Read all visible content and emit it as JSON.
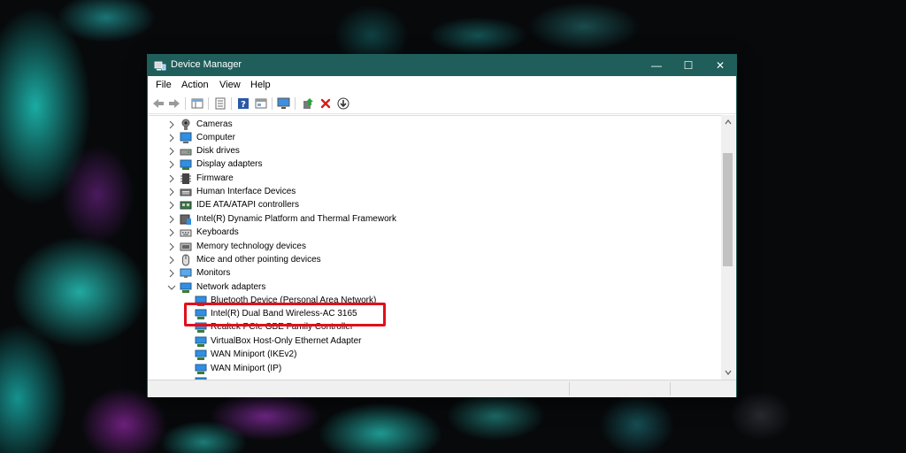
{
  "window": {
    "title": "Device Manager",
    "controls": {
      "minimize": "—",
      "maximize": "☐",
      "close": "✕"
    },
    "accent": "#1f5e5a"
  },
  "menu": {
    "file": "File",
    "action": "Action",
    "view": "View",
    "help": "Help"
  },
  "toolbar": {
    "buttons": [
      "back-icon",
      "forward-icon",
      "properties-grid-icon",
      "devices-view-icon",
      "help-icon",
      "resources-view-icon",
      "monitor-scan-icon",
      "update-driver-icon",
      "uninstall-icon",
      "download-icon"
    ]
  },
  "tree": {
    "categories": [
      {
        "label": "Cameras",
        "icon": "camera-icon"
      },
      {
        "label": "Computer",
        "icon": "computer-icon"
      },
      {
        "label": "Disk drives",
        "icon": "disk-drive-icon"
      },
      {
        "label": "Display adapters",
        "icon": "display-adapter-icon"
      },
      {
        "label": "Firmware",
        "icon": "firmware-icon"
      },
      {
        "label": "Human Interface Devices",
        "icon": "hid-icon"
      },
      {
        "label": "IDE ATA/ATAPI controllers",
        "icon": "ide-controller-icon"
      },
      {
        "label": "Intel(R) Dynamic Platform and Thermal Framework",
        "icon": "intel-dptf-icon"
      },
      {
        "label": "Keyboards",
        "icon": "keyboard-icon"
      },
      {
        "label": "Memory technology devices",
        "icon": "memory-device-icon"
      },
      {
        "label": "Mice and other pointing devices",
        "icon": "mouse-icon"
      },
      {
        "label": "Monitors",
        "icon": "monitor-icon"
      },
      {
        "label": "Network adapters",
        "icon": "network-adapter-icon",
        "expanded": true
      }
    ],
    "network_children": [
      {
        "label": "Bluetooth Device (Personal Area Network)"
      },
      {
        "label": "Intel(R) Dual Band Wireless-AC 3165",
        "highlighted": true
      },
      {
        "label": "Realtek PCIe GBE Family Controller"
      },
      {
        "label": "VirtualBox Host-Only Ethernet Adapter"
      },
      {
        "label": "WAN Miniport (IKEv2)"
      },
      {
        "label": "WAN Miniport (IP)"
      }
    ]
  },
  "annotation": {
    "color": "#e0101b"
  }
}
